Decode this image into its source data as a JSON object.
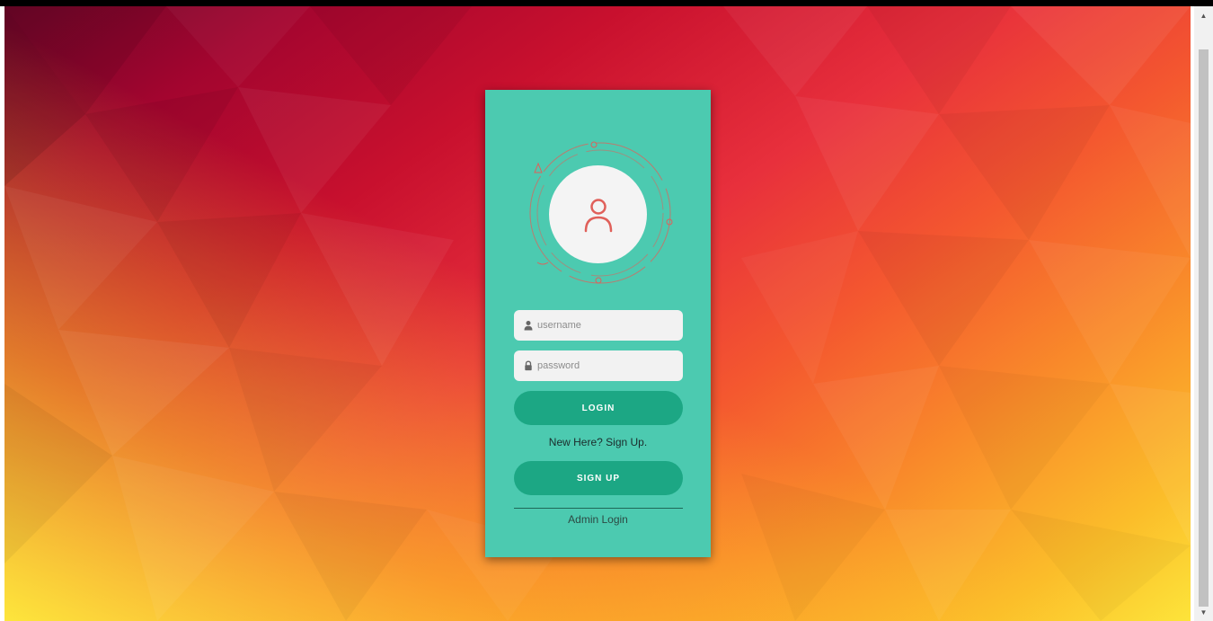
{
  "theme": {
    "card_color": "#4ccab0",
    "button_color": "#1ca784",
    "accent_icon_color": "#e0605a"
  },
  "login_form": {
    "avatar_icon": "user-icon",
    "username": {
      "icon": "user-icon",
      "placeholder": "username",
      "value": ""
    },
    "password": {
      "icon": "lock-icon",
      "placeholder": "password",
      "value": ""
    },
    "login_label": "LOGIN",
    "signup_prompt": "New Here? Sign Up.",
    "signup_label": "SIGN UP",
    "admin_label": "Admin Login"
  }
}
